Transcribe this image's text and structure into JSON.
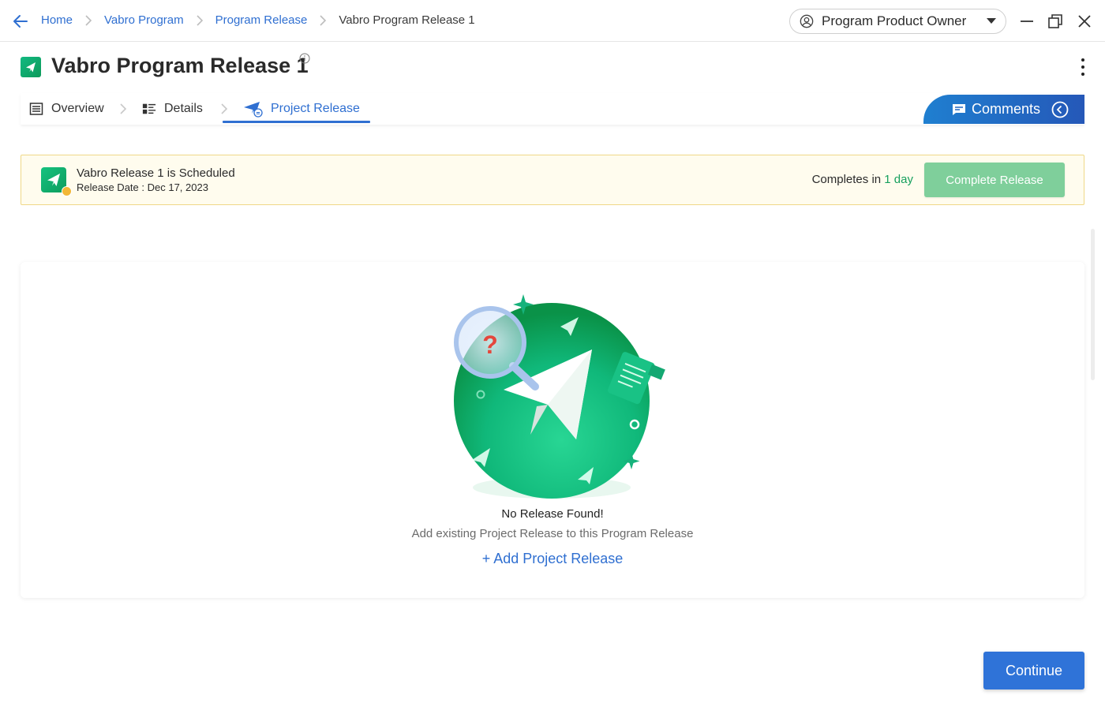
{
  "breadcrumb": {
    "items": [
      "Home",
      "Vabro Program",
      "Program Release"
    ],
    "current": "Vabro Program Release 1"
  },
  "role": {
    "label": "Program Product Owner"
  },
  "page": {
    "title": "Vabro Program Release 1"
  },
  "tabs": [
    {
      "label": "Overview",
      "icon": "list-icon",
      "active": false
    },
    {
      "label": "Details",
      "icon": "details-icon",
      "active": false
    },
    {
      "label": "Project Release",
      "icon": "release-plane-icon",
      "active": true
    }
  ],
  "comments": {
    "label": "Comments"
  },
  "banner": {
    "title": "Vabro Release 1 is Scheduled",
    "date": "Release Date : Dec 17, 2023",
    "completes_prefix": "Completes in",
    "completes_value": "1 day",
    "button": "Complete Release"
  },
  "empty_state": {
    "title": "No Release Found!",
    "subtitle": "Add existing Project Release to this Program Release",
    "action": "+ Add Project Release"
  },
  "footer": {
    "continue": "Continue"
  },
  "colors": {
    "accent": "#2f6fd1",
    "brand_green": "#12b981",
    "banner_bg": "#fffcee",
    "banner_border": "#efd888",
    "complete_button": "#7fcf9b",
    "comments_gradient": [
      "#1f7fd0",
      "#2558b8"
    ]
  }
}
